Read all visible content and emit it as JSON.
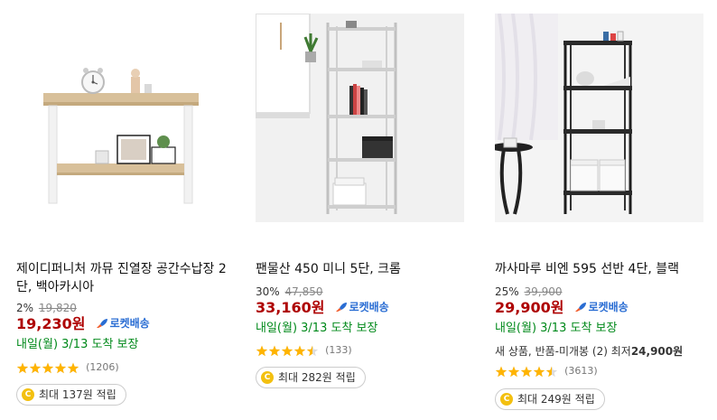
{
  "rocket_label": "로켓배송",
  "products": [
    {
      "name": "제이디퍼니처 까뮤 진열장 공간수납장 2단, 백아카시아",
      "discount_rate": "2%",
      "original_price": "19,820",
      "price": "19,230원",
      "delivery": "내일(월) 3/13 도착 보장",
      "rating": 5.0,
      "review_count": "(1206)",
      "reward": "최대 137원 적립"
    },
    {
      "name": "팬물산 450 미니 5단, 크롬",
      "discount_rate": "30%",
      "original_price": "47,850",
      "price": "33,160원",
      "delivery": "내일(월) 3/13 도착 보장",
      "rating": 4.5,
      "review_count": "(133)",
      "reward": "최대 282원 적립"
    },
    {
      "name": "까사마루 비엔 595 선반 4단, 블랙",
      "discount_rate": "25%",
      "original_price": "39,900",
      "price": "29,900원",
      "delivery": "내일(월) 3/13 도착 보장",
      "extra_prefix": "새 상품, 반품-미개봉 (2) 최저",
      "extra_price": "24,900원",
      "rating": 4.5,
      "review_count": "(3613)",
      "reward": "최대 249원 적립"
    }
  ],
  "colors": {
    "price": "#ae0000",
    "rocket": "#2a6dd3",
    "delivery": "#00891a",
    "star": "#ffb400",
    "coin": "#f3c010"
  }
}
